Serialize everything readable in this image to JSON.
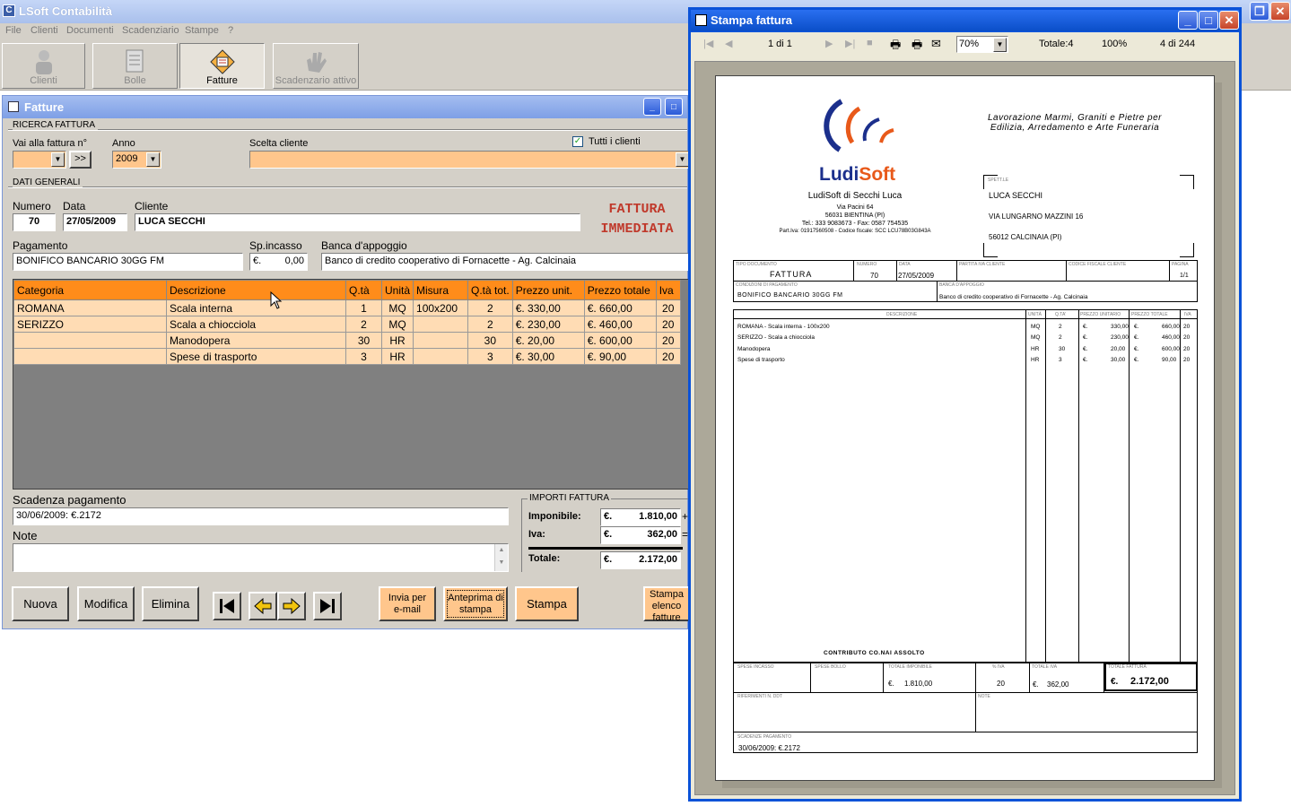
{
  "main": {
    "title": "LSoft Contabilità"
  },
  "menu": [
    "File",
    "Clienti",
    "Documenti",
    "Scadenziario",
    "Stampe",
    "?"
  ],
  "toolbar": {
    "clienti": "Clienti",
    "bolle": "Bolle",
    "fatture": "Fatture",
    "scadenzario": "Scadenzario attivo"
  },
  "fatture": {
    "title": "Fatture",
    "ricerca_group": "RICERCA FATTURA",
    "vai_label": "Vai alla fattura n°",
    "goto_btn": ">>",
    "anno_label": "Anno",
    "anno_value": "2009",
    "scelta_label": "Scelta cliente",
    "tutti_label": "Tutti i clienti",
    "dati_group": "DATI GENERALI",
    "numero_label": "Numero",
    "numero_value": "70",
    "data_label": "Data",
    "data_value": "27/05/2009",
    "cliente_label": "Cliente",
    "cliente_value": "LUCA SECCHI",
    "tipo_line1": "FATTURA",
    "tipo_line2": "IMMEDIATA",
    "pagamento_label": "Pagamento",
    "pagamento_value": "BONIFICO BANCARIO 30GG FM",
    "spincasso_label": "Sp.incasso",
    "spincasso_cur": "€.",
    "spincasso_value": "0,00",
    "banca_label": "Banca d'appoggio",
    "banca_value": "Banco di credito cooperativo di Fornacette - Ag. Calcinaia",
    "columns": [
      "Categoria",
      "Descrizione",
      "Q.tà",
      "Unità",
      "Misura",
      "Q.tà tot.",
      "Prezzo unit.",
      "Prezzo totale",
      "Iva"
    ],
    "rows": [
      [
        "ROMANA",
        "Scala interna",
        "1",
        "MQ",
        "100x200",
        "2",
        "€. 330,00",
        "€. 660,00",
        "20"
      ],
      [
        "SERIZZO",
        "Scala a chiocciola",
        "2",
        "MQ",
        "",
        "2",
        "€. 230,00",
        "€. 460,00",
        "20"
      ],
      [
        "",
        "Manodopera",
        "30",
        "HR",
        "",
        "30",
        "€. 20,00",
        "€. 600,00",
        "20"
      ],
      [
        "",
        "Spese di trasporto",
        "3",
        "HR",
        "",
        "3",
        "€. 30,00",
        "€. 90,00",
        "20"
      ]
    ],
    "scadenza_label": "Scadenza pagamento",
    "scadenza_value": "30/06/2009: €.2172",
    "note_label": "Note",
    "importi_group": "IMPORTI FATTURA",
    "imponibile_label": "Imponibile:",
    "imponibile_value": "1.810,00",
    "iva_label": "Iva:",
    "iva_value": "362,00",
    "totale_label": "Totale:",
    "totale_value": "2.172,00",
    "cur": "€.",
    "plus": "+",
    "eq": "=",
    "btn_nuova": "Nuova",
    "btn_modifica": "Modifica",
    "btn_elimina": "Elimina",
    "btn_invia_1": "Invia per",
    "btn_invia_2": "e-mail",
    "btn_anteprima_1": "Anteprima di",
    "btn_anteprima_2": "stampa",
    "btn_stampa": "Stampa",
    "btn_elenco_1": "Stampa",
    "btn_elenco_2": "elenco",
    "btn_elenco_3": "fatture"
  },
  "stampa": {
    "title": "Stampa fattura",
    "page_of": "1 di 1",
    "zoom": "70%",
    "totale": "Totale:4",
    "percent": "100%",
    "count": "4 di 244"
  },
  "doc": {
    "brand_a": "Ludi",
    "brand_b": "Soft",
    "slogan_1": "Lavorazione Marmi, Graniti e Pietre per",
    "slogan_2": "Edilizia, Arredamento e Arte Funeraria",
    "company": "LudiSoft di Secchi Luca",
    "addr1": "Via Pacini 64",
    "addr2": "56031 BIENTINA (PI)",
    "tel": "Tel.: 333 9083673 - Fax: 0587 754535",
    "piva": "Part.Iva: 01917560508 - Codice fiscale: SCC LCU78B03G843A",
    "spett": "SPETT.LE",
    "cli_name": "LUCA SECCHI",
    "cli_addr": "VIA LUNGARNO MAZZINI 16",
    "cli_city": "56012 CALCINAIA (PI)",
    "h_tipo": "TIPO DOCUMENTO",
    "h_numero": "NUMERO",
    "h_data": "DATA",
    "h_piva": "PARTITA IVA CLIENTE",
    "h_cf": "CODICE FISCALE CLIENTE",
    "h_pag": "PAGINA",
    "v_tipo": "FATTURA",
    "v_numero": "70",
    "v_data": "27/05/2009",
    "v_pag": "1/1",
    "h_cond": "CONDIZIONI DI PAGAMENTO",
    "h_banca": "BANCA D'APPOGGIO",
    "v_cond": "BONIFICO BANCARIO 30GG FM",
    "v_banca": "Banco di credito cooperativo di Fornacette - Ag. Calcinaia",
    "cols": [
      "DESCRIZIONE",
      "UNITÀ",
      "Q.TA'",
      "PREZZO UNITARIO",
      "PREZZO TOTALE",
      "IVA"
    ],
    "rows": [
      [
        "ROMANA - Scala interna - 100x200",
        "MQ",
        "2",
        "€.",
        "330,00",
        "€.",
        "660,00",
        "20"
      ],
      [
        "SERIZZO - Scala a chiocciola",
        "MQ",
        "2",
        "€.",
        "230,00",
        "€.",
        "460,00",
        "20"
      ],
      [
        "Manodopera",
        "HR",
        "30",
        "€.",
        "20,00",
        "€.",
        "600,00",
        "20"
      ],
      [
        "Spese di trasporto",
        "HR",
        "3",
        "€.",
        "30,00",
        "€.",
        "90,00",
        "20"
      ]
    ],
    "contributo": "CONTRIBUTO CO.NAI ASSOLTO",
    "f_spese": "SPESE INCASSO",
    "f_bollo": "SPESE BOLLO",
    "f_imp": "TOTALE IMPONIBILE",
    "f_iva_pct": "% IVA",
    "f_tot_iva": "TOTALE IVA",
    "f_tot": "TOTALE FATTURA",
    "v_imp": "1.810,00",
    "v_iva_pct": "20",
    "v_tot_iva": "362,00",
    "v_tot": "2.172,00",
    "cur": "€.",
    "f_rif": "RIFERIMENTI N. DDT",
    "f_note": "NOTE",
    "f_scad": "SCADENZE PAGAMENTO",
    "v_scad": "30/06/2009: €.2172"
  },
  "colors": {
    "accent": "#ff8c1a",
    "field_orange": "#ffc68c",
    "row": "#ffdcb4",
    "red_text": "#c0392b"
  }
}
